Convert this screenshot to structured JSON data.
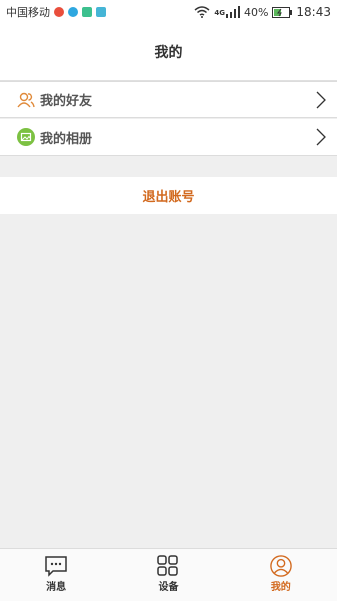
{
  "status_bar": {
    "carrier": "中国移动",
    "network": "4G",
    "battery": "40%",
    "time": "18:43"
  },
  "header": {
    "title": "我的"
  },
  "menu": [
    {
      "label": "我的好友",
      "icon": "friends-icon"
    },
    {
      "label": "我的相册",
      "icon": "album-icon"
    }
  ],
  "logout_label": "退出账号",
  "tabs": [
    {
      "label": "消息",
      "icon": "message-icon"
    },
    {
      "label": "设备",
      "icon": "devices-icon"
    },
    {
      "label": "我的",
      "icon": "profile-icon",
      "active": true
    }
  ],
  "colors": {
    "accent": "#d2691e",
    "album_green": "#7cc142"
  }
}
